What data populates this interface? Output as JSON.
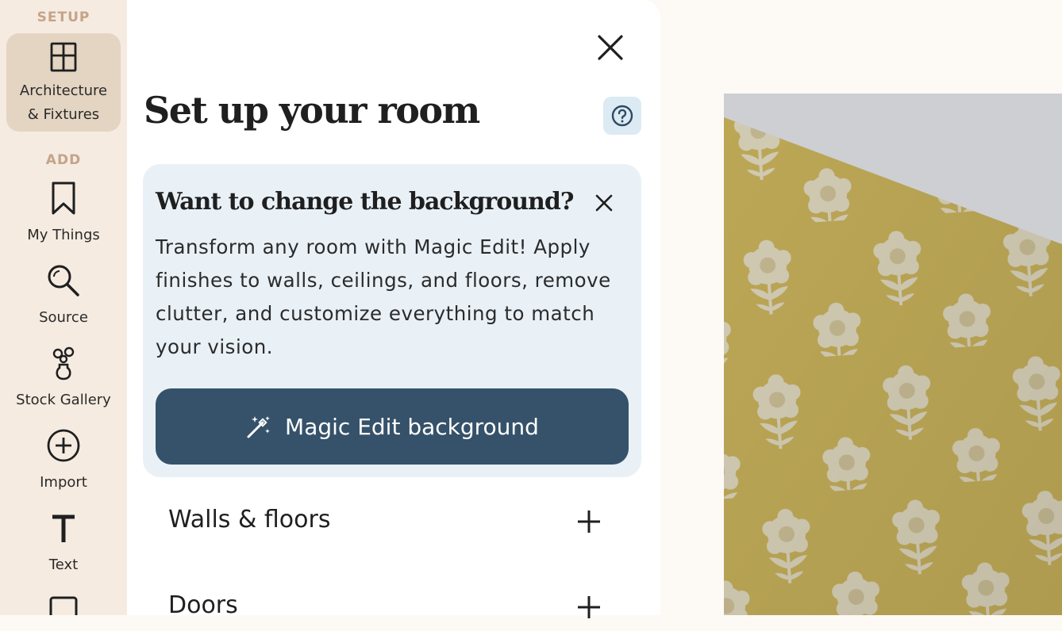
{
  "rail": {
    "setup_heading": "SETUP",
    "add_heading": "ADD",
    "items": [
      {
        "label_line1": "Architecture",
        "label_line2": "& Fixtures",
        "icon": "window-frame-icon"
      },
      {
        "label": "My Things",
        "icon": "bookmark-icon"
      },
      {
        "label": "Source",
        "icon": "search-icon"
      },
      {
        "label": "Stock Gallery",
        "icon": "flower-vase-icon"
      },
      {
        "label": "Import",
        "icon": "plus-circle-icon"
      },
      {
        "label": "Text",
        "icon": "text-t-icon"
      }
    ]
  },
  "panel": {
    "title": "Set up your room",
    "promo": {
      "title": "Want to change the background?",
      "body": "Transform any room with Magic Edit! Apply finishes to walls, ceilings, and floors, remove clutter, and customize everything to match your vision.",
      "button_label": "Magic Edit background"
    },
    "sections": [
      {
        "label": "Walls & floors"
      },
      {
        "label": "Doors"
      }
    ]
  },
  "colors": {
    "rail_bg": "#f5ebe1",
    "rail_active": "#e4d5c3",
    "promo_bg": "#e9f1f7",
    "button_bg": "#36526a",
    "wallpaper": "#c8b460",
    "wallpaper_flower": "#e2dcc4"
  }
}
